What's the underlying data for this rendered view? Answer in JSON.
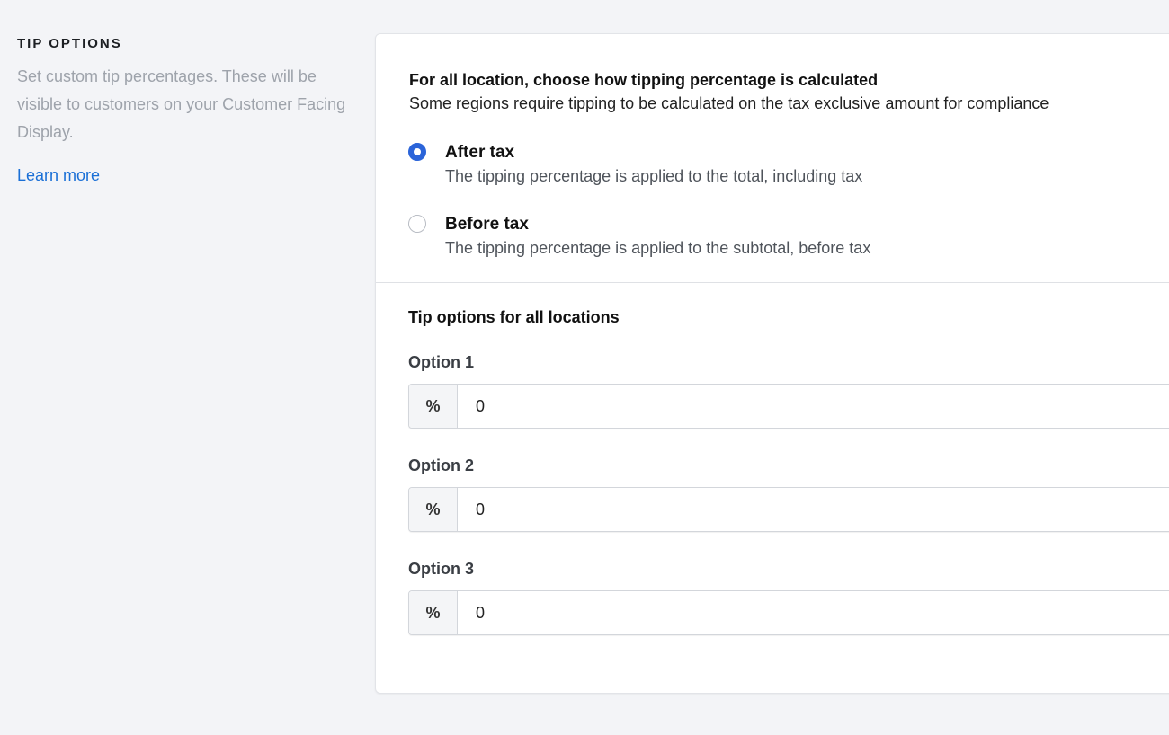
{
  "section": {
    "title": "TIP OPTIONS",
    "description": "Set custom tip percentages. These will be visible to customers on your Customer Facing Display.",
    "learn_more": "Learn more"
  },
  "calculation": {
    "title": "For all location, choose how tipping percentage is calculated",
    "description": "Some regions require tipping to be calculated on the tax exclusive amount for compliance",
    "options": [
      {
        "label": "After tax",
        "help": "The tipping percentage is applied to the total, including tax",
        "selected": true
      },
      {
        "label": "Before tax",
        "help": "The tipping percentage is applied to the subtotal, before tax",
        "selected": false
      }
    ]
  },
  "tips": {
    "title": "Tip options for all locations",
    "options": [
      {
        "label": "Option 1",
        "addon": "%",
        "value": "0"
      },
      {
        "label": "Option 2",
        "addon": "%",
        "value": "0"
      },
      {
        "label": "Option 3",
        "addon": "%",
        "value": "0"
      }
    ]
  },
  "colors": {
    "accent": "#2b64d9",
    "link": "#1a6fd6",
    "background": "#f3f4f7"
  }
}
